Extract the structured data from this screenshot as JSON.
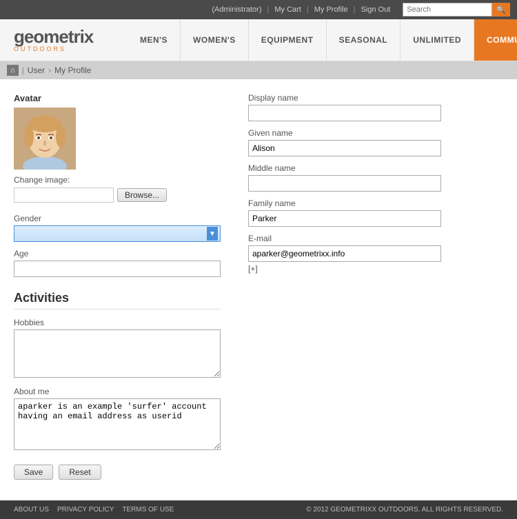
{
  "topbar": {
    "admin_label": "(Administrator)",
    "my_cart": "My Cart",
    "my_profile": "My Profile",
    "sign_out": "Sign Out",
    "search_placeholder": "Search"
  },
  "logo": {
    "name": "geometrix",
    "sub": "OUTDOORS"
  },
  "nav": {
    "items": [
      {
        "id": "mens",
        "label": "MEN'S"
      },
      {
        "id": "womens",
        "label": "WOMEN'S"
      },
      {
        "id": "equipment",
        "label": "EQUIPMENT"
      },
      {
        "id": "seasonal",
        "label": "SEASONAL"
      },
      {
        "id": "unlimited",
        "label": "UNLIMITED"
      },
      {
        "id": "community",
        "label": "COMMUNITY"
      }
    ]
  },
  "breadcrumb": {
    "home_icon": "⌂",
    "user_label": "User",
    "current": "My Profile"
  },
  "profile": {
    "avatar_section": "Avatar",
    "change_image_label": "Change image:",
    "browse_btn": "Browse...",
    "gender_label": "Gender",
    "age_label": "Age",
    "display_name_label": "Display name",
    "display_name_value": "",
    "given_name_label": "Given name",
    "given_name_value": "Alison",
    "middle_name_label": "Middle name",
    "middle_name_value": "",
    "family_name_label": "Family name",
    "family_name_value": "Parker",
    "email_label": "E-mail",
    "email_value": "aparker@geometrixx.info",
    "email_add": "[+]",
    "activities_header": "Activities",
    "hobbies_label": "Hobbies",
    "hobbies_value": "",
    "about_me_label": "About me",
    "about_me_text": "aparker is an example 'surfer' account having an email address as userid",
    "about_me_username": "aparker",
    "about_me_userid": "userid",
    "save_btn": "Save",
    "reset_btn": "Reset"
  },
  "footer": {
    "about": "ABOUT US",
    "privacy": "PRIVACY POLICY",
    "terms": "TERMS OF USE",
    "copyright": "© 2012 GEOMETRIXX OUTDOORS. ALL RIGHTS RESERVED."
  }
}
